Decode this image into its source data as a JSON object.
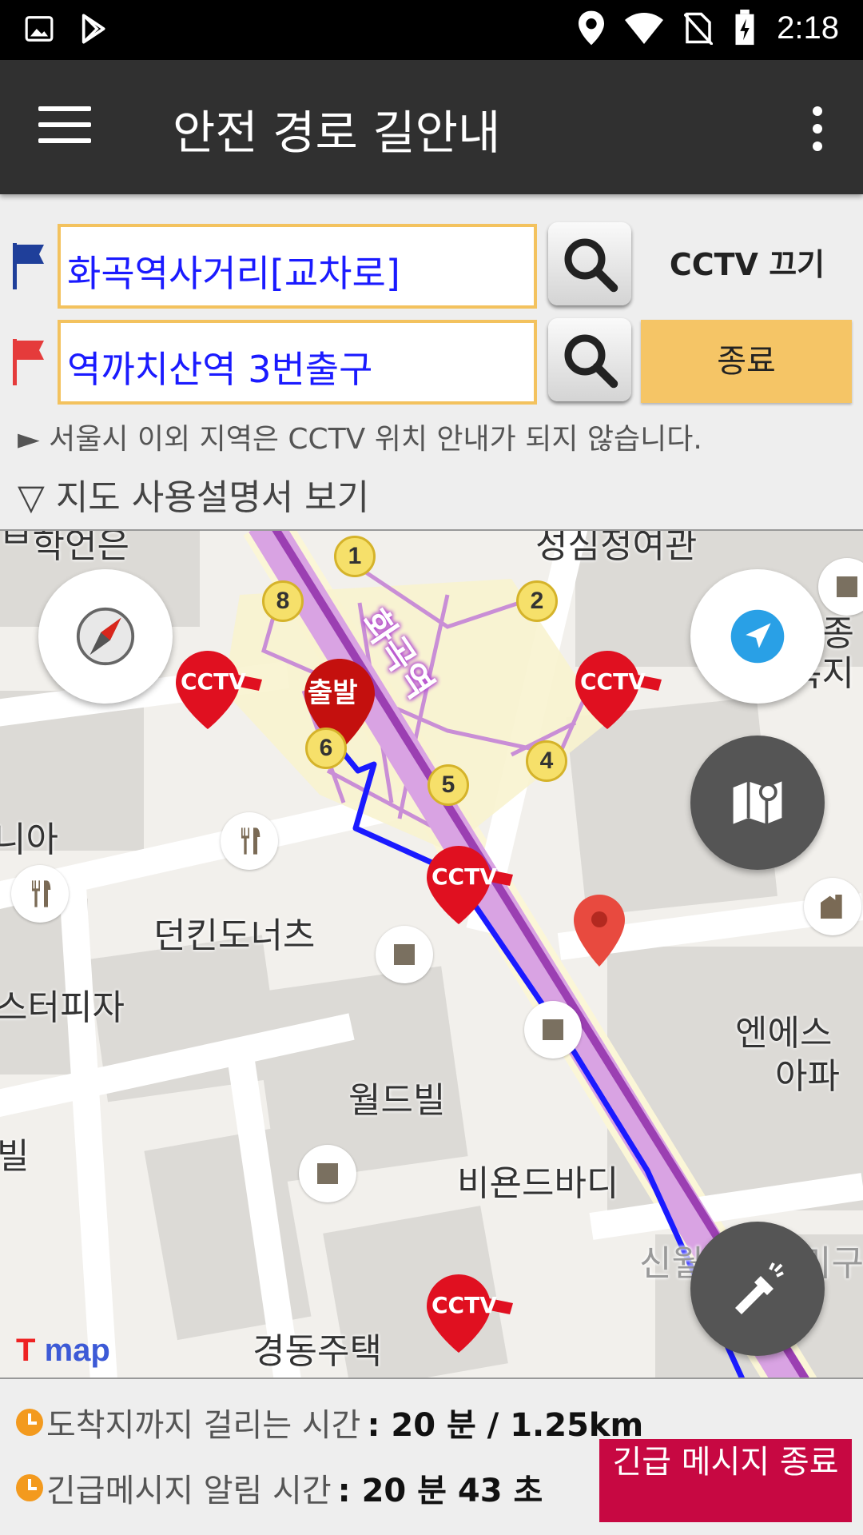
{
  "status_bar": {
    "time": "2:18",
    "icons": [
      "image-icon",
      "play-store-icon",
      "location-icon",
      "wifi-icon",
      "no-sim-icon",
      "battery-charging-icon"
    ]
  },
  "app_bar": {
    "title": "안전 경로 길안내",
    "menu_icon": "hamburger-menu-icon",
    "overflow_icon": "more-vertical-icon"
  },
  "route": {
    "origin": {
      "value": "화곡역사거리[교차로]",
      "flag_color": "#1f3f9a"
    },
    "destination": {
      "value": "역까치산역 3번출구",
      "flag_color": "#e53b3b"
    },
    "cctv_toggle_label": "CCTV 끄기",
    "end_button_label": "종료",
    "notice": "► 서울시 이외 지역은 CCTV 위치 안내가 되지 않습니다.",
    "manual_toggle": "▽ 지도 사용설명서 보기"
  },
  "map": {
    "station_label": "화곡역",
    "start_marker_label": "출발",
    "cctv_label": "CCTV",
    "exit_numbers": [
      "1",
      "2",
      "4",
      "5",
      "6",
      "8"
    ],
    "labels": {
      "top_center": "성심정여관",
      "top_left": "ᄇ학언은",
      "left_mid": "니아",
      "dunkin": "던킨도너츠",
      "pizza": "스터피자",
      "bill": "빌",
      "worldbill": "월드빌",
      "beyond": "비욘드바디",
      "gyeongdong": "경동주택",
      "seojong": "서종",
      "bokji": "복지",
      "ns": "엔에스",
      "apart": "아파",
      "sinwol": "신월",
      "sinwol_right": "미구"
    },
    "logo": "map",
    "route_color": "#1a1aff",
    "subway_color": "#9b3fb2"
  },
  "info": {
    "arrival_label": "도착지까지 걸리는 시간",
    "arrival_value": ": 20 분 / 1.25km",
    "alert_label": "긴급메시지 알림 시간",
    "alert_value": ": 20 분 43 초",
    "emergency_button": "긴급 메시지 종료"
  }
}
